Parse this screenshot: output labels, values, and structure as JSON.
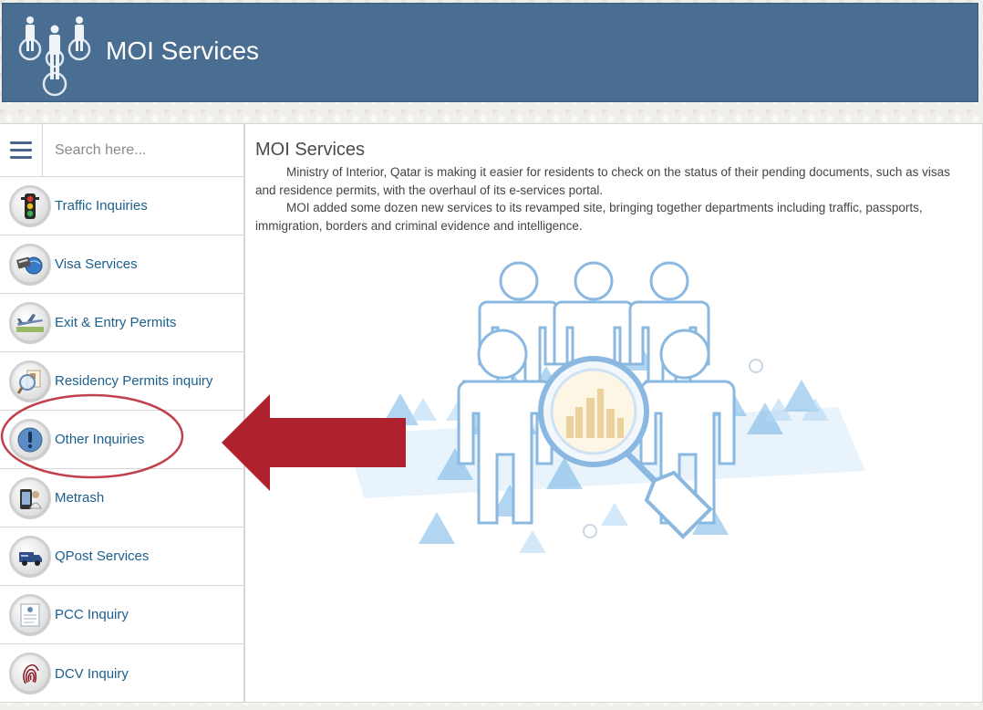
{
  "header": {
    "title": "MOI Services",
    "logo_icon": "people-network-icon",
    "bg_color": "#4a6e92"
  },
  "sidebar": {
    "menu_icon": "hamburger-icon",
    "search": {
      "placeholder": "Search here...",
      "value": ""
    },
    "items": [
      {
        "label": "Traffic Inquiries",
        "icon": "traffic-light-icon"
      },
      {
        "label": "Visa Services",
        "icon": "visa-globe-icon"
      },
      {
        "label": "Exit & Entry Permits",
        "icon": "airplane-icon"
      },
      {
        "label": "Residency Permits inquiry",
        "icon": "magnifier-document-icon"
      },
      {
        "label": "Other Inquiries",
        "icon": "exclamation-icon"
      },
      {
        "label": "Metrash",
        "icon": "metrash-phone-icon"
      },
      {
        "label": "QPost Services",
        "icon": "delivery-truck-icon"
      },
      {
        "label": "PCC Inquiry",
        "icon": "certificate-icon"
      },
      {
        "label": "DCV Inquiry",
        "icon": "fingerprint-icon"
      }
    ],
    "link_color": "#1b5f8c"
  },
  "main": {
    "title": "MOI Services",
    "paragraphs": [
      "Ministry of Interior, Qatar is making it easier for residents to check on the status of their pending documents, such as visas and residence permits, with the overhaul of its e-services portal.",
      "MOI added some dozen new services to its revamped site, bringing together departments including traffic, passports, immigration, borders and criminal evidence and intelligence."
    ],
    "illustration_icon": "people-search-illustration"
  },
  "annotation": {
    "arrow_icon": "left-arrow-icon",
    "highlight": "Other Inquiries",
    "color": "#b0212f"
  }
}
